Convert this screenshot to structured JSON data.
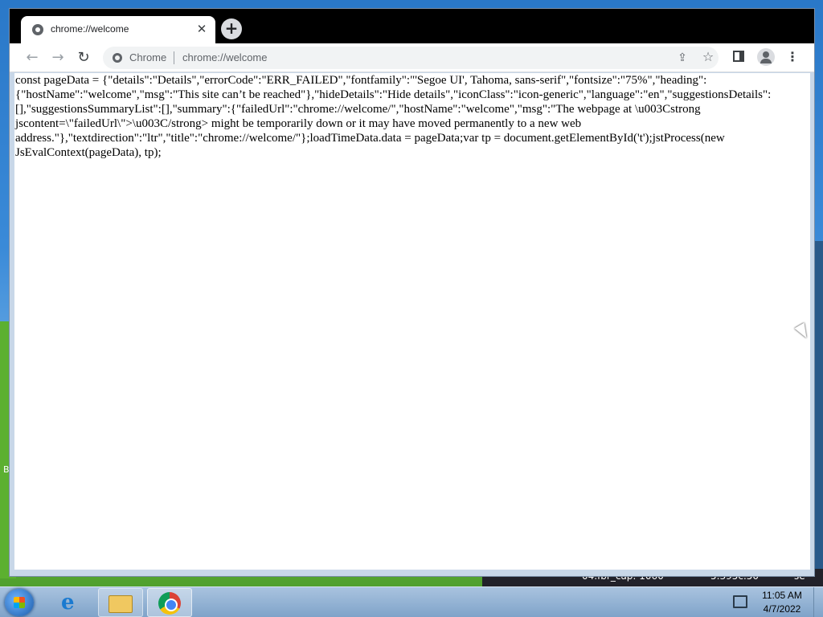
{
  "desktop": {
    "left_edge_text": "B",
    "bottom_strip_text_1": "04.fbr_cap: 1060",
    "bottom_strip_text_2": "5.395c.50",
    "bottom_strip_text_3": "se"
  },
  "browser": {
    "tab": {
      "title": "chrome://welcome",
      "close_glyph": "✕"
    },
    "new_tab_glyph": "+",
    "toolbar": {
      "back_glyph": "←",
      "forward_glyph": "→",
      "reload_glyph": "↻",
      "omnibox_chip": "Chrome",
      "url": "chrome://welcome",
      "share_glyph": "⇪",
      "star_glyph": "☆",
      "menu_glyph": "⋮"
    },
    "page_text": "const pageData = {\"details\":\"Details\",\"errorCode\":\"ERR_FAILED\",\"fontfamily\":\"'Segoe UI', Tahoma, sans-serif\",\"fontsize\":\"75%\",\"heading\":{\"hostName\":\"welcome\",\"msg\":\"This site can’t be reached\"},\"hideDetails\":\"Hide details\",\"iconClass\":\"icon-generic\",\"language\":\"en\",\"suggestionsDetails\":[],\"suggestionsSummaryList\":[],\"summary\":{\"failedUrl\":\"chrome://welcome/\",\"hostName\":\"welcome\",\"msg\":\"The webpage at \\u003Cstrong jscontent=\\\"failedUrl\\\">\\u003C/strong> might be temporarily down or it may have moved permanently to a new web address.\"},\"textdirection\":\"ltr\",\"title\":\"chrome://welcome/\"};loadTimeData.data = pageData;var tp = document.getElementById('t');jstProcess(new JsEvalContext(pageData), tp);"
  },
  "taskbar": {
    "ie_glyph": "e",
    "clock_time": "11:05 AM",
    "clock_date": "4/7/2022"
  },
  "icons": [
    "globe-icon",
    "close-icon",
    "plus-icon",
    "back-arrow-icon",
    "forward-arrow-icon",
    "reload-icon",
    "chrome-site-icon",
    "share-icon",
    "star-icon",
    "side-panel-icon",
    "profile-icon",
    "kebab-menu-icon",
    "mouse-cursor-icon",
    "windows-start-icon",
    "internet-explorer-icon",
    "folder-icon",
    "chrome-icon",
    "network-icon"
  ]
}
